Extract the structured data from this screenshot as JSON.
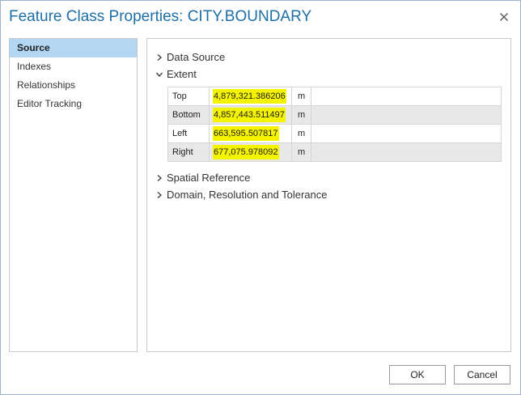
{
  "window": {
    "title": "Feature Class Properties: CITY.BOUNDARY"
  },
  "sidebar": {
    "items": [
      {
        "label": "Source",
        "active": true
      },
      {
        "label": "Indexes",
        "active": false
      },
      {
        "label": "Relationships",
        "active": false
      },
      {
        "label": "Editor Tracking",
        "active": false
      }
    ]
  },
  "content": {
    "sections": {
      "data_source": {
        "label": "Data Source",
        "expanded": false
      },
      "extent": {
        "label": "Extent",
        "expanded": true
      },
      "spatial_reference": {
        "label": "Spatial Reference",
        "expanded": false
      },
      "domain": {
        "label": "Domain, Resolution and Tolerance",
        "expanded": false
      }
    },
    "extent_rows": [
      {
        "label": "Top",
        "value": "4,879,321.386206",
        "unit": "m"
      },
      {
        "label": "Bottom",
        "value": "4,857,443.511497",
        "unit": "m"
      },
      {
        "label": "Left",
        "value": "663,595.507817",
        "unit": "m"
      },
      {
        "label": "Right",
        "value": "677,075.978092",
        "unit": "m"
      }
    ]
  },
  "buttons": {
    "ok": "OK",
    "cancel": "Cancel"
  },
  "colors": {
    "title": "#1d6fa5",
    "active_item": "#b3d7f3",
    "highlight": "#f4f400"
  },
  "icons": {
    "close": "close-icon",
    "collapsed": "chevron-right-icon",
    "expanded": "chevron-down-icon"
  }
}
